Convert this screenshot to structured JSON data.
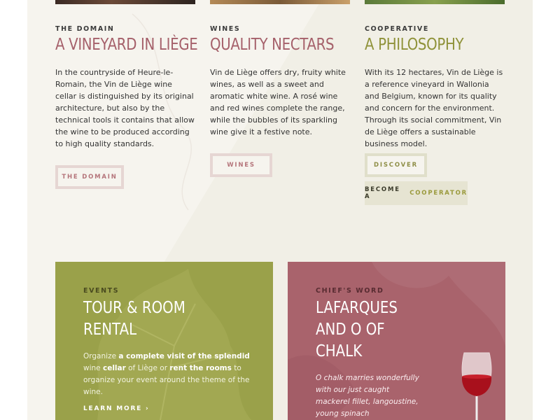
{
  "columns": [
    {
      "kicker": "THE DOMAIN",
      "title": "A VINEYARD IN LIÈGE",
      "text": "In the countryside of Heure-le-Romain, the Vin de Liège wine cellar is distinguished by its original architecture, but also by the technical tools it contains that allow the wine to be produced according to high quality standards.",
      "button": "THE DOMAIN"
    },
    {
      "kicker": "WINES",
      "title": "QUALITY NECTARS",
      "text": "Vin de Liège offers dry, fruity white wines, as well as a sweet and aromatic white wine. A rosé wine and red wines complete the range, while the bubbles of its sparkling wine give it a festive note.",
      "button": "WINES"
    },
    {
      "kicker": "COOPERATIVE",
      "title": "A PHILOSOPHY",
      "text": "With its 12 hectares, Vin de Liège is a reference vineyard in Wallonia and Belgium, known for its quality and concern for the environment. Through its social commitment, Vin de Liège offers a sustainable business model.",
      "button": "DISCOVER",
      "button2_prefix": "BECOME A",
      "button2_accent": "COOPERATOR"
    }
  ],
  "events": {
    "kicker": "EVENTS",
    "title": "TOUR & ROOM RENTAL",
    "text_1": "Organize ",
    "bold_1": "a complete visit of the splendid",
    "text_2": " wine ",
    "bold_2": "cellar",
    "text_3": " of Liège or ",
    "bold_3": "rent the rooms",
    "text_4": " to organize your event around the theme of the wine.",
    "link": "LEARN MORE ›"
  },
  "chief": {
    "kicker": "CHIEF'S WORD",
    "title_line1": "LAFARQUES",
    "title_line2": "AND O OF",
    "title_line3": "CHALK",
    "quote": "O chalk marries wonderfully with our just caught mackerel fillet, langoustine, young spinach"
  },
  "colors": {
    "page_bg": "#f6f4ee",
    "rose": "#a5606a",
    "olive": "#8f9239",
    "events_card": "#9aa14a",
    "chief_card": "#a9636c"
  }
}
